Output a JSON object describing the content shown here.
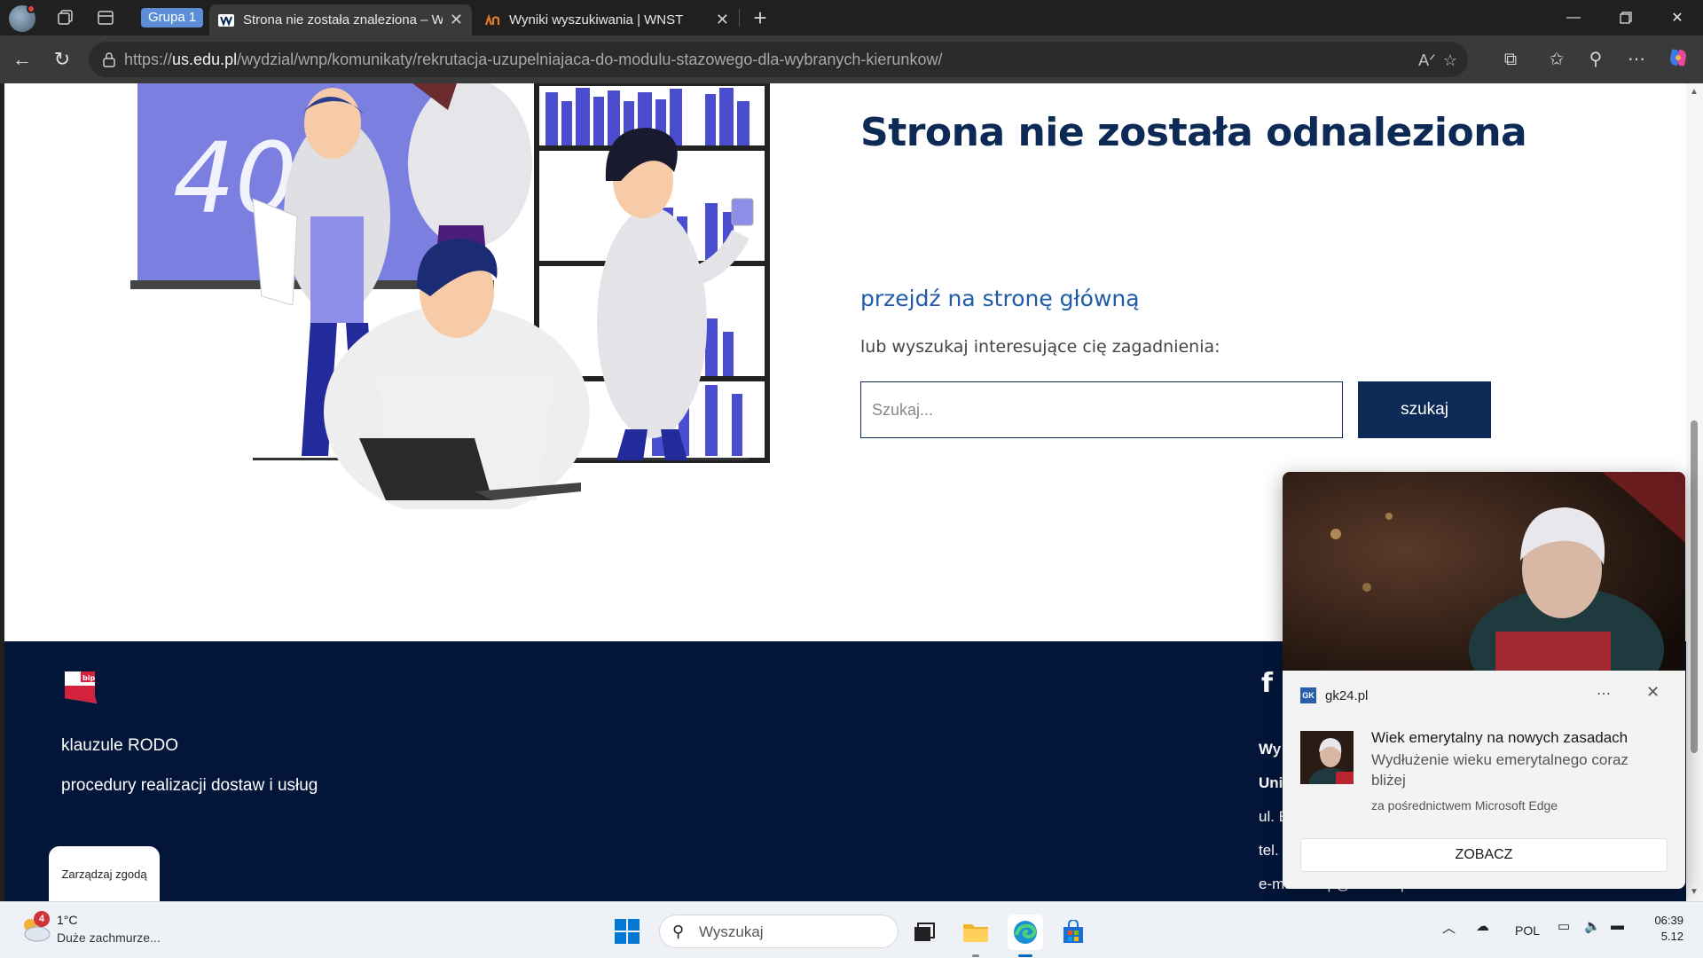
{
  "browser": {
    "group_label": "Grupa 1",
    "tabs": [
      {
        "title": "Strona nie została znaleziona – W",
        "active": true
      },
      {
        "title": "Wyniki wyszukiwania | WNST",
        "active": false
      }
    ],
    "url_prefix": "https://",
    "url_domain": "us.edu.pl",
    "url_path": "/wydzial/wnp/komunikaty/rekrutacja-uzupelniajaca-do-modulu-stazowego-dla-wybranych-kierunkow/"
  },
  "page": {
    "title": "Strona nie została odnaleziona",
    "home_link": "przejdź na stronę główną",
    "search_hint": "lub wyszukaj interesujące cię zagadnienia:",
    "search_placeholder": "Szukaj...",
    "search_button": "szukaj",
    "illustration_text": "404",
    "colors": {
      "primary": "#0c2a55",
      "link": "#1f5ba8",
      "footer": "#03163a"
    }
  },
  "footer": {
    "bip_label": "bip",
    "links": [
      "klauzule RODO",
      "procedury realizacji dostaw i usług"
    ],
    "info_lines": [
      "Wy",
      "Uni",
      "ul. E",
      "tel.",
      "e-mail: wnp@us.edu.pl"
    ],
    "consent_button": "Zarządzaj zgodą",
    "social_icon": "facebook-icon"
  },
  "notification": {
    "source": "gk24.pl",
    "source_badge": "GK",
    "title": "Wiek emerytalny na nowych zasadach",
    "body": "Wydłużenie wieku emerytalnego coraz bliżej",
    "via": "za pośrednictwem Microsoft Edge",
    "action": "ZOBACZ"
  },
  "taskbar": {
    "weather_badge": "4",
    "temperature": "1°C",
    "weather_desc": "Duże zachmurze...",
    "search_placeholder": "Wyszukaj",
    "language": "POL",
    "time": "06:39",
    "date": "5.12"
  }
}
